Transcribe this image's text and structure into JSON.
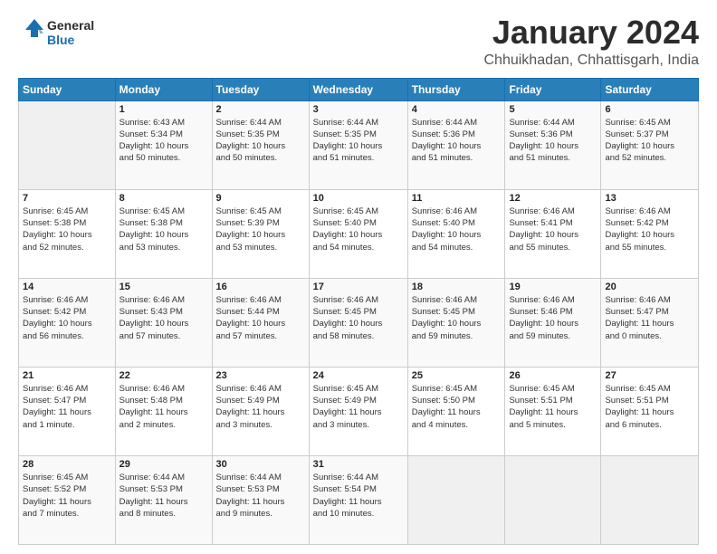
{
  "header": {
    "logo_line1": "General",
    "logo_line2": "Blue",
    "title": "January 2024",
    "subtitle": "Chhuikhadan, Chhattisgarh, India"
  },
  "calendar": {
    "days_of_week": [
      "Sunday",
      "Monday",
      "Tuesday",
      "Wednesday",
      "Thursday",
      "Friday",
      "Saturday"
    ],
    "weeks": [
      [
        {
          "day": "",
          "content": ""
        },
        {
          "day": "1",
          "content": "Sunrise: 6:43 AM\nSunset: 5:34 PM\nDaylight: 10 hours\nand 50 minutes."
        },
        {
          "day": "2",
          "content": "Sunrise: 6:44 AM\nSunset: 5:35 PM\nDaylight: 10 hours\nand 50 minutes."
        },
        {
          "day": "3",
          "content": "Sunrise: 6:44 AM\nSunset: 5:35 PM\nDaylight: 10 hours\nand 51 minutes."
        },
        {
          "day": "4",
          "content": "Sunrise: 6:44 AM\nSunset: 5:36 PM\nDaylight: 10 hours\nand 51 minutes."
        },
        {
          "day": "5",
          "content": "Sunrise: 6:44 AM\nSunset: 5:36 PM\nDaylight: 10 hours\nand 51 minutes."
        },
        {
          "day": "6",
          "content": "Sunrise: 6:45 AM\nSunset: 5:37 PM\nDaylight: 10 hours\nand 52 minutes."
        }
      ],
      [
        {
          "day": "7",
          "content": "Sunrise: 6:45 AM\nSunset: 5:38 PM\nDaylight: 10 hours\nand 52 minutes."
        },
        {
          "day": "8",
          "content": "Sunrise: 6:45 AM\nSunset: 5:38 PM\nDaylight: 10 hours\nand 53 minutes."
        },
        {
          "day": "9",
          "content": "Sunrise: 6:45 AM\nSunset: 5:39 PM\nDaylight: 10 hours\nand 53 minutes."
        },
        {
          "day": "10",
          "content": "Sunrise: 6:45 AM\nSunset: 5:40 PM\nDaylight: 10 hours\nand 54 minutes."
        },
        {
          "day": "11",
          "content": "Sunrise: 6:46 AM\nSunset: 5:40 PM\nDaylight: 10 hours\nand 54 minutes."
        },
        {
          "day": "12",
          "content": "Sunrise: 6:46 AM\nSunset: 5:41 PM\nDaylight: 10 hours\nand 55 minutes."
        },
        {
          "day": "13",
          "content": "Sunrise: 6:46 AM\nSunset: 5:42 PM\nDaylight: 10 hours\nand 55 minutes."
        }
      ],
      [
        {
          "day": "14",
          "content": "Sunrise: 6:46 AM\nSunset: 5:42 PM\nDaylight: 10 hours\nand 56 minutes."
        },
        {
          "day": "15",
          "content": "Sunrise: 6:46 AM\nSunset: 5:43 PM\nDaylight: 10 hours\nand 57 minutes."
        },
        {
          "day": "16",
          "content": "Sunrise: 6:46 AM\nSunset: 5:44 PM\nDaylight: 10 hours\nand 57 minutes."
        },
        {
          "day": "17",
          "content": "Sunrise: 6:46 AM\nSunset: 5:45 PM\nDaylight: 10 hours\nand 58 minutes."
        },
        {
          "day": "18",
          "content": "Sunrise: 6:46 AM\nSunset: 5:45 PM\nDaylight: 10 hours\nand 59 minutes."
        },
        {
          "day": "19",
          "content": "Sunrise: 6:46 AM\nSunset: 5:46 PM\nDaylight: 10 hours\nand 59 minutes."
        },
        {
          "day": "20",
          "content": "Sunrise: 6:46 AM\nSunset: 5:47 PM\nDaylight: 11 hours\nand 0 minutes."
        }
      ],
      [
        {
          "day": "21",
          "content": "Sunrise: 6:46 AM\nSunset: 5:47 PM\nDaylight: 11 hours\nand 1 minute."
        },
        {
          "day": "22",
          "content": "Sunrise: 6:46 AM\nSunset: 5:48 PM\nDaylight: 11 hours\nand 2 minutes."
        },
        {
          "day": "23",
          "content": "Sunrise: 6:46 AM\nSunset: 5:49 PM\nDaylight: 11 hours\nand 3 minutes."
        },
        {
          "day": "24",
          "content": "Sunrise: 6:45 AM\nSunset: 5:49 PM\nDaylight: 11 hours\nand 3 minutes."
        },
        {
          "day": "25",
          "content": "Sunrise: 6:45 AM\nSunset: 5:50 PM\nDaylight: 11 hours\nand 4 minutes."
        },
        {
          "day": "26",
          "content": "Sunrise: 6:45 AM\nSunset: 5:51 PM\nDaylight: 11 hours\nand 5 minutes."
        },
        {
          "day": "27",
          "content": "Sunrise: 6:45 AM\nSunset: 5:51 PM\nDaylight: 11 hours\nand 6 minutes."
        }
      ],
      [
        {
          "day": "28",
          "content": "Sunrise: 6:45 AM\nSunset: 5:52 PM\nDaylight: 11 hours\nand 7 minutes."
        },
        {
          "day": "29",
          "content": "Sunrise: 6:44 AM\nSunset: 5:53 PM\nDaylight: 11 hours\nand 8 minutes."
        },
        {
          "day": "30",
          "content": "Sunrise: 6:44 AM\nSunset: 5:53 PM\nDaylight: 11 hours\nand 9 minutes."
        },
        {
          "day": "31",
          "content": "Sunrise: 6:44 AM\nSunset: 5:54 PM\nDaylight: 11 hours\nand 10 minutes."
        },
        {
          "day": "",
          "content": ""
        },
        {
          "day": "",
          "content": ""
        },
        {
          "day": "",
          "content": ""
        }
      ]
    ]
  }
}
